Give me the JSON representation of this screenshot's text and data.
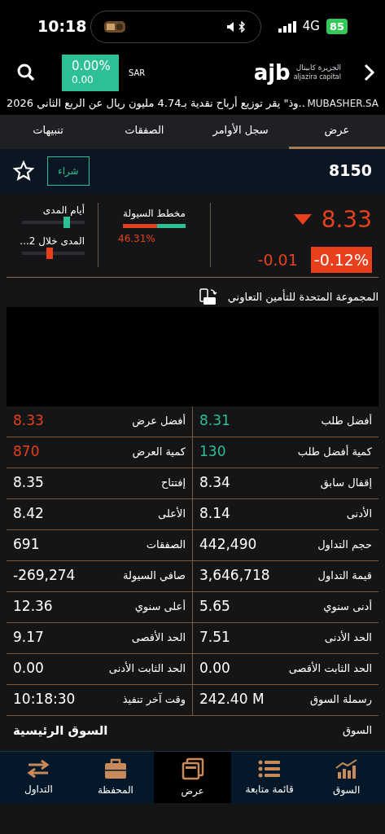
{
  "status_bar": {
    "time": "10:18",
    "network": "4G",
    "battery": "85"
  },
  "header": {
    "index_change": "0.00%",
    "index_points": "0.00",
    "currency": "SAR",
    "logo_text": "ajb",
    "logo_name_ar": "الجزيرة كابيتال",
    "logo_name_en": "aljazira capital"
  },
  "news_ticker": {
    "source": "MUBASHER.SA",
    "headline": "..وذ\" يقر توزيع أرباح نقدية بـ4.74 مليون ريال عن الربع الثاني 2026"
  },
  "tabs": [
    {
      "label": "عرض",
      "selected": true
    },
    {
      "label": "سجل الأوامر",
      "selected": false
    },
    {
      "label": "الصفقات",
      "selected": false
    },
    {
      "label": "تنبيهات",
      "selected": false
    }
  ],
  "stock": {
    "symbol": "8150",
    "buy_label": "شراء",
    "favorite": false
  },
  "price": {
    "last": "8.33",
    "kind": "down",
    "change": "-0.01",
    "change_percent": "-0.12%"
  },
  "liquidity": {
    "title": "مخطط السيولة",
    "level": 0.54,
    "reading": "46.31%"
  },
  "ranges": [
    {
      "label": "أيام المدى",
      "level": 0.72,
      "color": "#2dbf96"
    },
    {
      "label": "المدى خلال 2...",
      "level": 0.44,
      "color": "#e8401c"
    }
  ],
  "company": {
    "name": "المجموعة المتحدة للتأمين التعاوني"
  },
  "quote_rows": [
    {
      "right": {
        "label": "أفضل طلب",
        "value": "8.31",
        "color": "#2dbf96"
      },
      "left": {
        "label": "أفضل عرض",
        "value": "8.33",
        "color": "#e8401c"
      }
    },
    {
      "right": {
        "label": "كمية أفضل طلب",
        "value": "130",
        "color": "#2dbf96"
      },
      "left": {
        "label": "كمية العرض",
        "value": "870",
        "color": "#e8401c"
      }
    },
    {
      "right": {
        "label": "إقفال سابق",
        "value": "8.34"
      },
      "left": {
        "label": "إفتتاح",
        "value": "8.35"
      }
    },
    {
      "right": {
        "label": "الأدنى",
        "value": "8.14"
      },
      "left": {
        "label": "الأعلى",
        "value": "8.42"
      }
    },
    {
      "right": {
        "label": "حجم التداول",
        "value": "442,490"
      },
      "left": {
        "label": "الصفقات",
        "value": "691"
      }
    },
    {
      "right": {
        "label": "قيمة التداول",
        "value": "3,646,718"
      },
      "left": {
        "label": "صافي السيولة",
        "value": "-269,274"
      }
    },
    {
      "right": {
        "label": "أدنى سنوي",
        "value": "5.65"
      },
      "left": {
        "label": "أعلى سنوي",
        "value": "12.36"
      }
    },
    {
      "right": {
        "label": "الحد الأدنى",
        "value": "7.51"
      },
      "left": {
        "label": "الحد الأقصى",
        "value": "9.17"
      }
    },
    {
      "right": {
        "label": "الحد الثابت الأقصى",
        "value": "0.00"
      },
      "left": {
        "label": "الحد الثابت الأدنى",
        "value": "0.00"
      }
    },
    {
      "right": {
        "label": "رسملة السوق",
        "value": "242.40 M"
      },
      "left": {
        "label": "وقت آخر تنفيذ",
        "value": "10:18:30"
      }
    }
  ],
  "market": {
    "label": "السوق",
    "value": "السوق الرئيسية"
  },
  "bottom_nav": [
    {
      "label": "السوق",
      "kind": "chart",
      "selected": false
    },
    {
      "label": "قائمة متابعة",
      "kind": "list",
      "selected": false
    },
    {
      "label": "عرض",
      "kind": "windows",
      "selected": true
    },
    {
      "label": "المحفظة",
      "kind": "briefcase",
      "selected": false
    },
    {
      "label": "التداول",
      "kind": "swap",
      "selected": false
    }
  ]
}
